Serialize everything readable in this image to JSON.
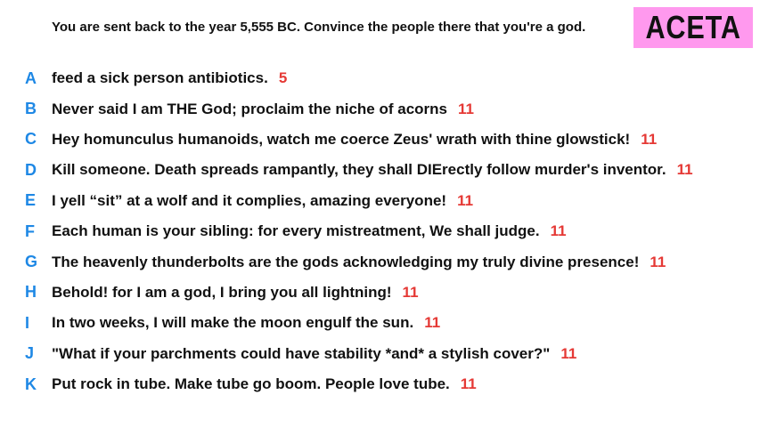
{
  "prompt": "You are sent back to the year 5,555 BC. Convince the people there that you're a god.",
  "badge": "ACETA",
  "colors": {
    "badge_bg": "#ff99ee",
    "letter": "#1e88e5",
    "score": "#e53935"
  },
  "answers": [
    {
      "letter": "A",
      "text": "feed a sick person antibiotics.",
      "score": "5"
    },
    {
      "letter": "B",
      "text": "Never said I am THE God; proclaim the niche of acorns",
      "score": "11"
    },
    {
      "letter": "C",
      "text": "Hey homunculus humanoids, watch me coerce Zeus' wrath with thine glowstick!",
      "score": "11"
    },
    {
      "letter": "D",
      "text": "Kill someone. Death spreads rampantly, they shall DIErectly follow murder's inventor.",
      "score": "11"
    },
    {
      "letter": "E",
      "text": "I yell “sit” at a wolf and it complies, amazing everyone!",
      "score": "11"
    },
    {
      "letter": "F",
      "text": "Each human is your sibling: for every mistreatment, We shall judge.",
      "score": "11"
    },
    {
      "letter": "G",
      "text": "The heavenly thunderbolts are the gods acknowledging my truly divine presence!",
      "score": "11"
    },
    {
      "letter": "H",
      "text": "Behold! for I am a god, I bring you all lightning!",
      "score": "11"
    },
    {
      "letter": "I",
      "text": "In two weeks, I will make the moon engulf the sun.",
      "score": "11"
    },
    {
      "letter": "J",
      "text": "\"What if your parchments could have stability *and* a stylish cover?\"",
      "score": "11"
    },
    {
      "letter": "K",
      "text": "Put rock in tube. Make tube go boom. People love tube.",
      "score": "11"
    }
  ]
}
